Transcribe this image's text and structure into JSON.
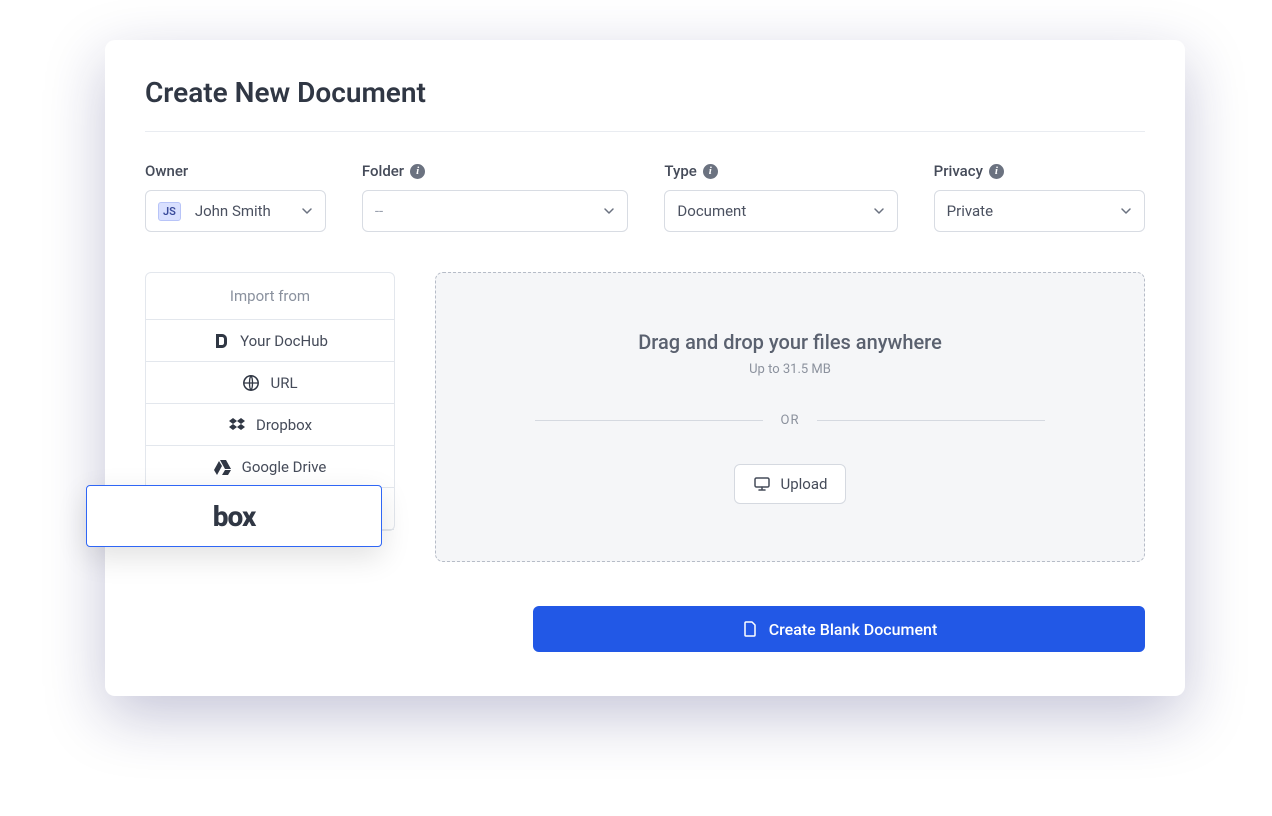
{
  "title": "Create New Document",
  "fields": {
    "owner": {
      "label": "Owner",
      "initials": "JS",
      "value": "John Smith"
    },
    "folder": {
      "label": "Folder",
      "value": "--"
    },
    "type": {
      "label": "Type",
      "value": "Document"
    },
    "privacy": {
      "label": "Privacy",
      "value": "Private"
    }
  },
  "import": {
    "heading": "Import from",
    "items": {
      "dochub": "Your DocHub",
      "url": "URL",
      "dropbox": "Dropbox",
      "gdrive": "Google Drive",
      "box": "box"
    }
  },
  "dropzone": {
    "title": "Drag and drop your files anywhere",
    "subtitle": "Up to 31.5 MB",
    "or": "OR",
    "upload": "Upload"
  },
  "primary_button": "Create Blank Document"
}
